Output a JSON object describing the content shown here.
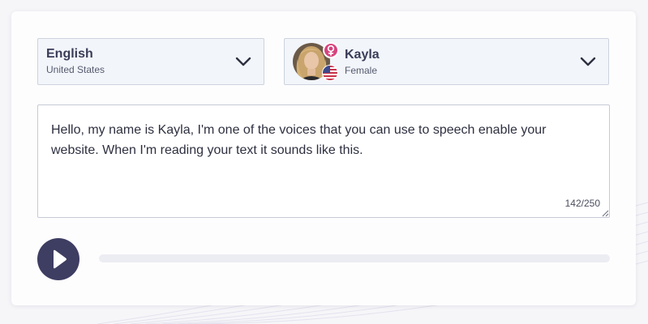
{
  "language_select": {
    "language": "English",
    "region": "United States"
  },
  "voice_select": {
    "name": "Kayla",
    "gender": "Female",
    "gender_icon": "female-symbol-icon",
    "flag_icon": "us-flag-icon"
  },
  "text_input": {
    "value": "Hello, my name is Kayla, I'm one of the voices that you can use to speech enable your website. When I'm reading your text it sounds like this.",
    "counter": "142/250"
  },
  "player": {
    "play_icon": "play-icon",
    "progress": 0
  },
  "colors": {
    "accent": "#3e3d62",
    "gender_badge": "#d6437f",
    "select_bg": "#f2f5fa",
    "progress_track": "#ececf3"
  }
}
